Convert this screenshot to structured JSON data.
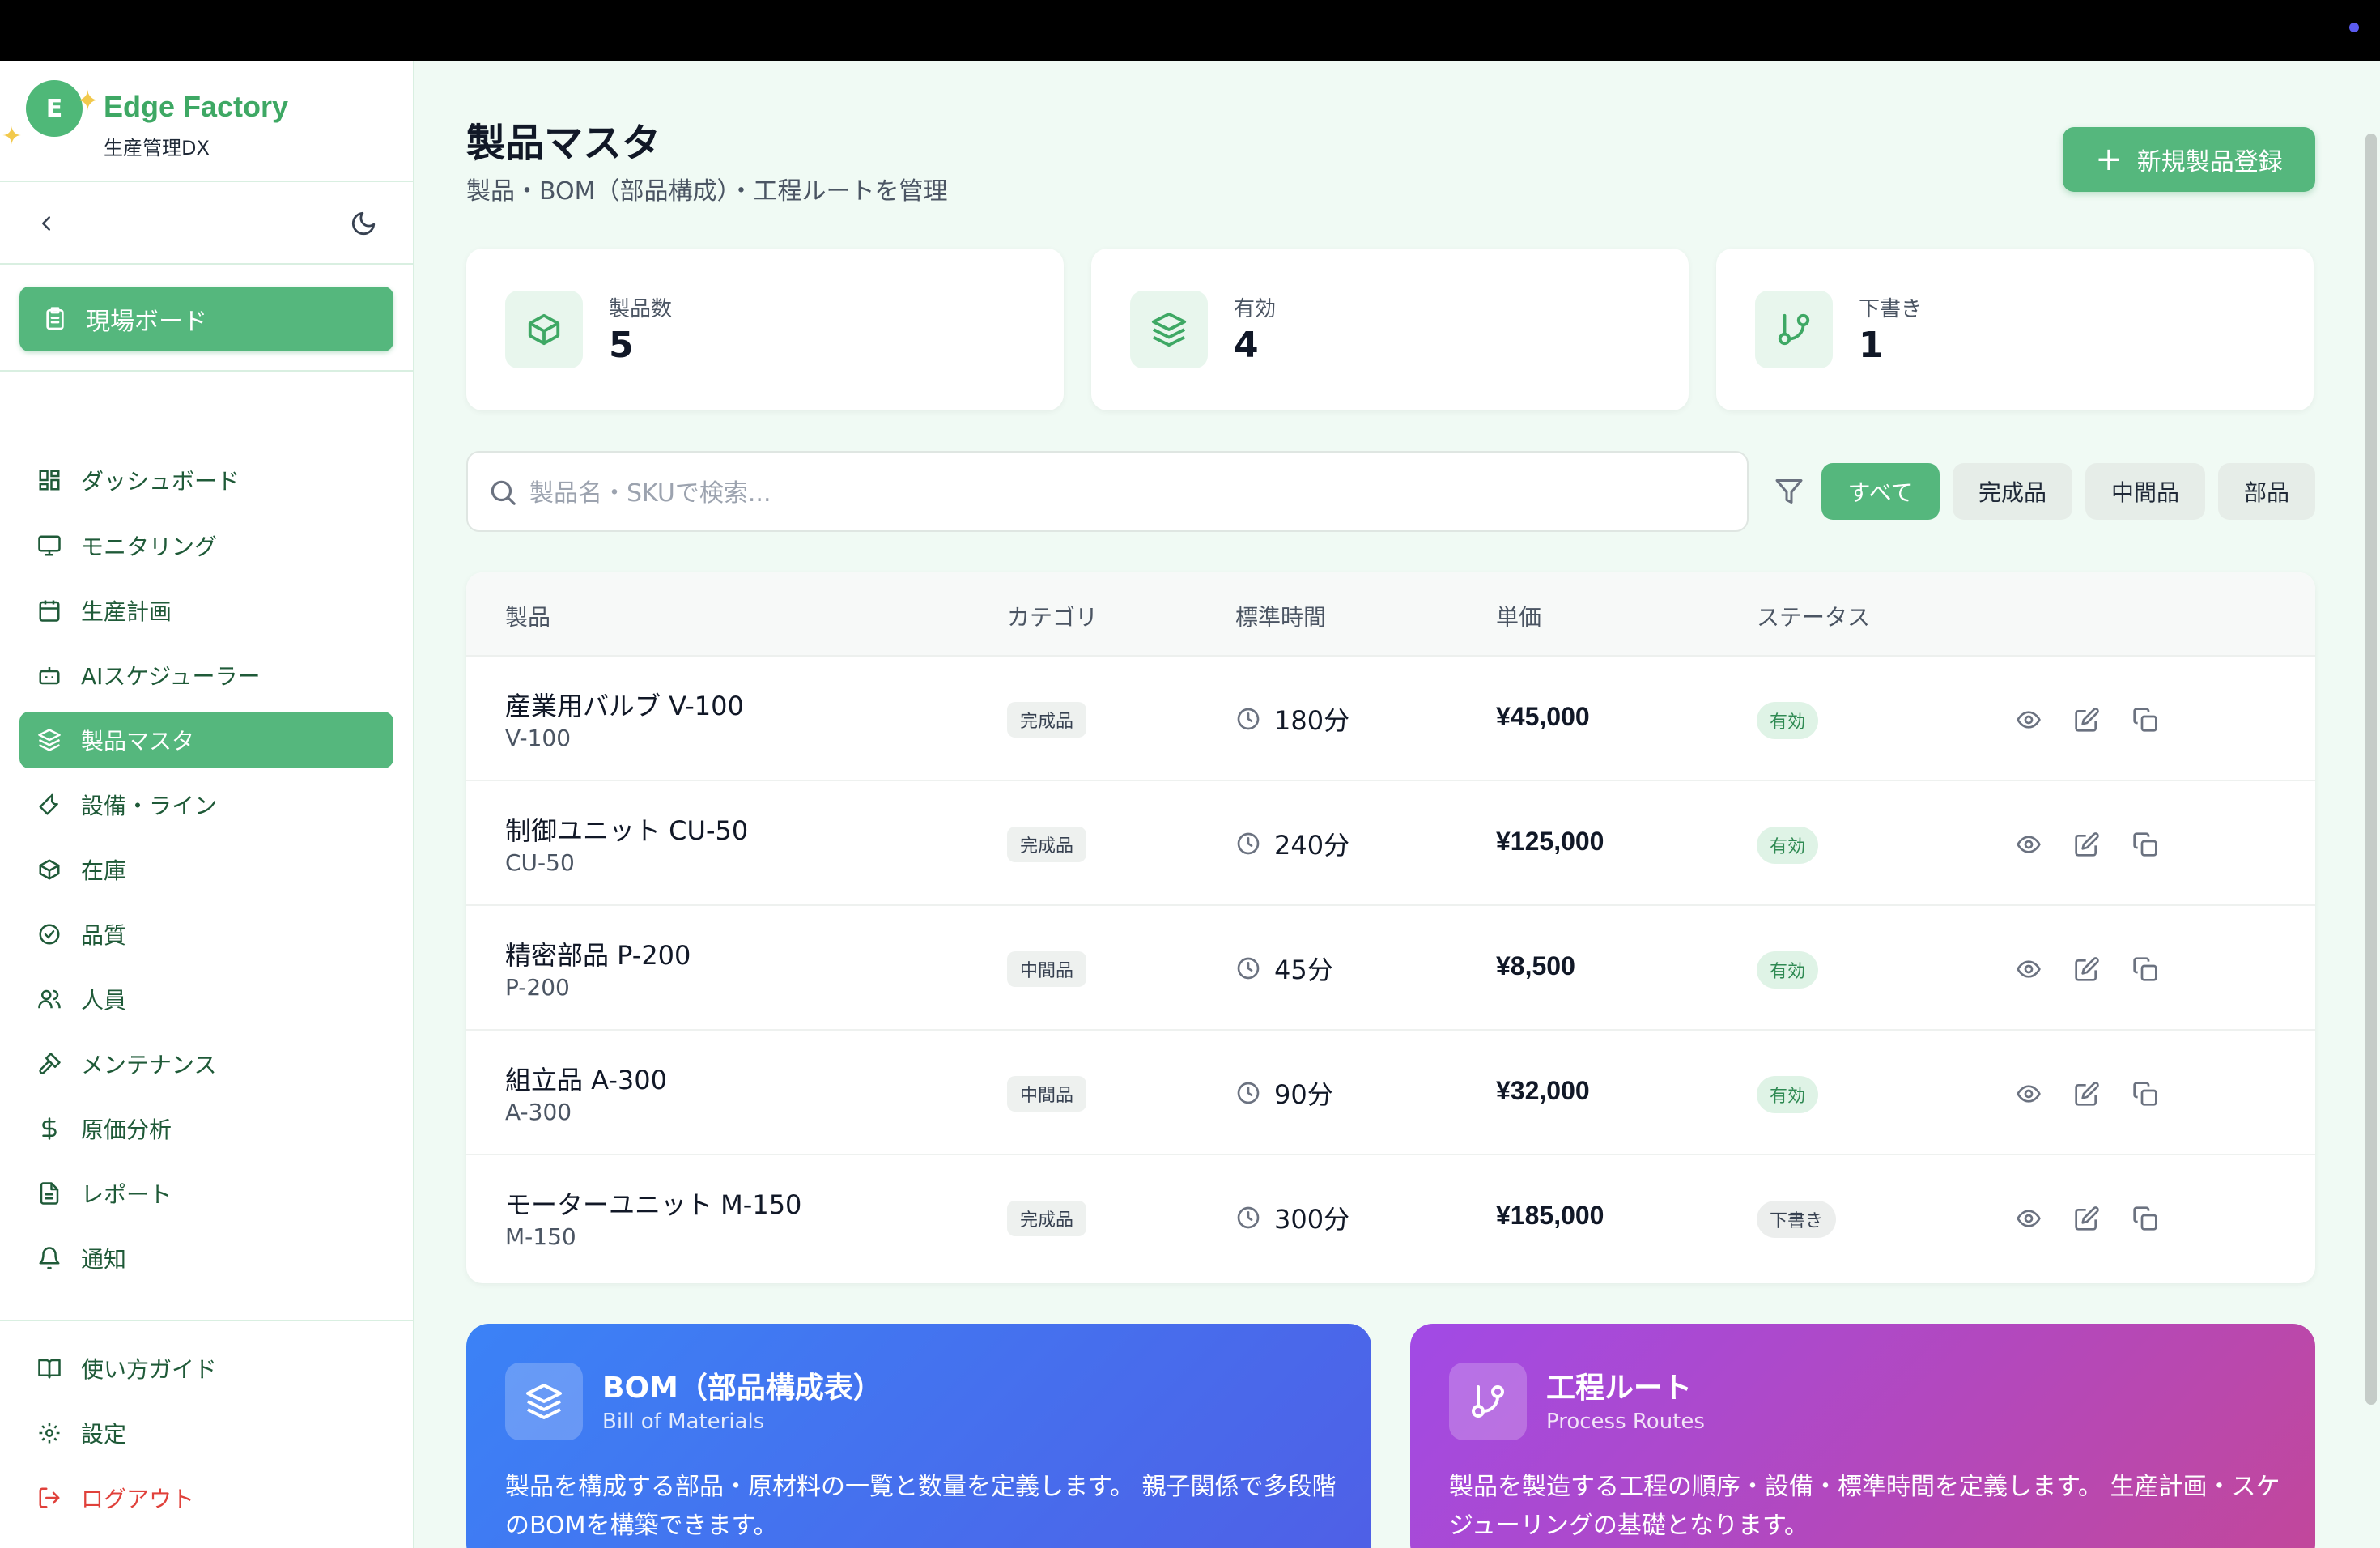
{
  "brand": {
    "initial": "E",
    "name": "Edge Factory",
    "sub": "生産管理DX"
  },
  "sidebar": {
    "board_label": "現場ボード",
    "items": [
      {
        "label": "ダッシュボード",
        "icon": "dashboard-icon"
      },
      {
        "label": "モニタリング",
        "icon": "monitor-icon"
      },
      {
        "label": "生産計画",
        "icon": "calendar-icon"
      },
      {
        "label": "AIスケジューラー",
        "icon": "bot-icon"
      },
      {
        "label": "製品マスタ",
        "icon": "layers-icon",
        "active": true
      },
      {
        "label": "設備・ライン",
        "icon": "wrench-icon"
      },
      {
        "label": "在庫",
        "icon": "box-icon"
      },
      {
        "label": "品質",
        "icon": "check-circle-icon"
      },
      {
        "label": "人員",
        "icon": "users-icon"
      },
      {
        "label": "メンテナンス",
        "icon": "hammer-icon"
      },
      {
        "label": "原価分析",
        "icon": "dollar-icon"
      },
      {
        "label": "レポート",
        "icon": "file-icon"
      },
      {
        "label": "通知",
        "icon": "bell-icon"
      }
    ],
    "bottom": [
      {
        "label": "使い方ガイド",
        "icon": "book-icon"
      },
      {
        "label": "設定",
        "icon": "gear-icon"
      },
      {
        "label": "ログアウト",
        "icon": "logout-icon"
      }
    ]
  },
  "header": {
    "title": "製品マスタ",
    "subtitle": "製品・BOM（部品構成）・工程ルートを管理",
    "new_button": "新規製品登録"
  },
  "stats": [
    {
      "label": "製品数",
      "value": "5"
    },
    {
      "label": "有効",
      "value": "4"
    },
    {
      "label": "下書き",
      "value": "1"
    }
  ],
  "search": {
    "placeholder": "製品名・SKUで検索..."
  },
  "filters": [
    "すべて",
    "完成品",
    "中間品",
    "部品"
  ],
  "table": {
    "headers": [
      "製品",
      "カテゴリ",
      "標準時間",
      "単価",
      "ステータス"
    ],
    "rows": [
      {
        "name": "産業用バルブ V-100",
        "sku": "V-100",
        "category": "完成品",
        "time": "180分",
        "price": "¥45,000",
        "status": "有効"
      },
      {
        "name": "制御ユニット CU-50",
        "sku": "CU-50",
        "category": "完成品",
        "time": "240分",
        "price": "¥125,000",
        "status": "有効"
      },
      {
        "name": "精密部品 P-200",
        "sku": "P-200",
        "category": "中間品",
        "time": "45分",
        "price": "¥8,500",
        "status": "有効"
      },
      {
        "name": "組立品 A-300",
        "sku": "A-300",
        "category": "中間品",
        "time": "90分",
        "price": "¥32,000",
        "status": "有効"
      },
      {
        "name": "モーターユニット M-150",
        "sku": "M-150",
        "category": "完成品",
        "time": "300分",
        "price": "¥185,000",
        "status": "下書き"
      }
    ]
  },
  "cards": {
    "bom": {
      "title": "BOM（部品構成表）",
      "subtitle": "Bill of Materials",
      "desc": "製品を構成する部品・原材料の一覧と数量を定義します。 親子関係で多段階のBOMを構築できます。"
    },
    "route": {
      "title": "工程ルート",
      "subtitle": "Process Routes",
      "desc": "製品を製造する工程の順序・設備・標準時間を定義します。 生産計画・スケジューリングの基礎となります。"
    }
  },
  "colors": {
    "accent": "#55b77d",
    "brand_text": "#3ea864",
    "danger": "#e0413b"
  }
}
